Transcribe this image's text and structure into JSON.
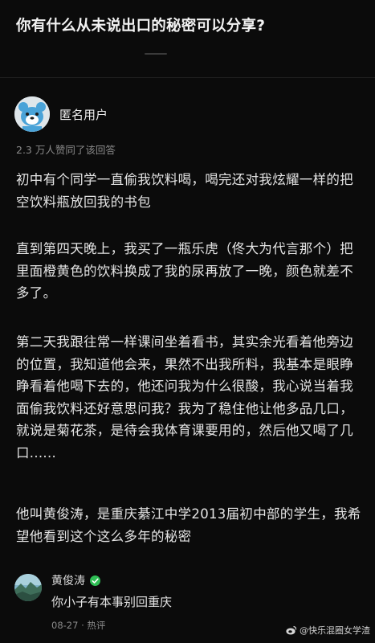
{
  "question": {
    "title": "你有什么从未说出口的秘密可以分享?"
  },
  "answer": {
    "author": "匿名用户",
    "avatar_icon": "anonymous-bear-icon",
    "votes": "2.3 万人赞同了该回答",
    "paragraphs": [
      "初中有个同学一直偷我饮料喝，喝完还对我炫耀一样的把空饮料瓶放回我的书包",
      "直到第四天晚上，我买了一瓶乐虎（佟大为代言那个）把里面橙黄色的饮料换成了我的尿再放了一晚，颜色就差不多了。",
      "第二天我跟往常一样课间坐着看书，其实余光看着他旁边的位置，我知道他会来，果然不出我所料，我基本是眼睁睁看着他喝下去的，他还问我为什么很酸，我心说当着我面偷我饮料还好意思问我？我为了稳住他让他多品几口，就说是菊花茶，是待会我体育课要用的，然后他又喝了几口......",
      "他叫黄俊涛，是重庆綦江中学2013届初中部的学生，我希望他看到这个这么多年的秘密"
    ]
  },
  "comment": {
    "author": "黄俊涛",
    "verified_icon": "verified-badge-icon",
    "text": "你小子有本事别回重庆",
    "date": "08-27",
    "separator": "·",
    "tag": "热评"
  },
  "watermark": {
    "icon": "weibo-icon",
    "text": "@快乐混圈女学渣"
  },
  "colors": {
    "background": "#0b0b0b",
    "text": "#e4e4e4",
    "muted": "#8a8a8a",
    "verified": "#2fbf55"
  }
}
